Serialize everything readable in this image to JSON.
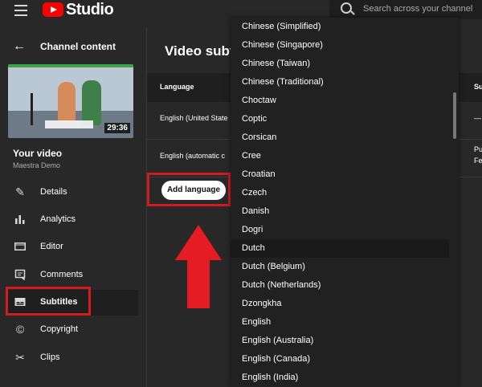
{
  "topbar": {
    "logo_text": "Studio",
    "search_placeholder": "Search across your channel"
  },
  "sidebar": {
    "title": "Channel content",
    "thumb_duration": "29:36",
    "your_video": "Your video",
    "channel": "Maestra Demo",
    "items": [
      {
        "label": "Details",
        "icon": "pencil-icon"
      },
      {
        "label": "Analytics",
        "icon": "bar-chart-icon"
      },
      {
        "label": "Editor",
        "icon": "film-icon"
      },
      {
        "label": "Comments",
        "icon": "comment-icon"
      },
      {
        "label": "Subtitles",
        "icon": "subtitles-icon",
        "active": true
      },
      {
        "label": "Copyright",
        "icon": "copyright-icon"
      },
      {
        "label": "Clips",
        "icon": "scissors-icon"
      }
    ]
  },
  "main": {
    "title": "Video subt",
    "col_language": "Language",
    "col_right": "Su",
    "rows": [
      {
        "language": "English (United State",
        "right": "—",
        "right2": ""
      },
      {
        "language": "English (automatic c",
        "right": "Pu",
        "right2": "Fe"
      }
    ],
    "add_language": "Add language"
  },
  "dropdown": {
    "selected": "Dutch",
    "items": [
      "Chinese (Simplified)",
      "Chinese (Singapore)",
      "Chinese (Taiwan)",
      "Chinese (Traditional)",
      "Choctaw",
      "Coptic",
      "Corsican",
      "Cree",
      "Croatian",
      "Czech",
      "Danish",
      "Dogri",
      "Dutch",
      "Dutch (Belgium)",
      "Dutch (Netherlands)",
      "Dzongkha",
      "English",
      "English (Australia)",
      "English (Canada)",
      "English (India)"
    ]
  },
  "colors": {
    "highlight": "#d31a20",
    "arrow": "#e61c24",
    "brand": "#ff0000"
  }
}
